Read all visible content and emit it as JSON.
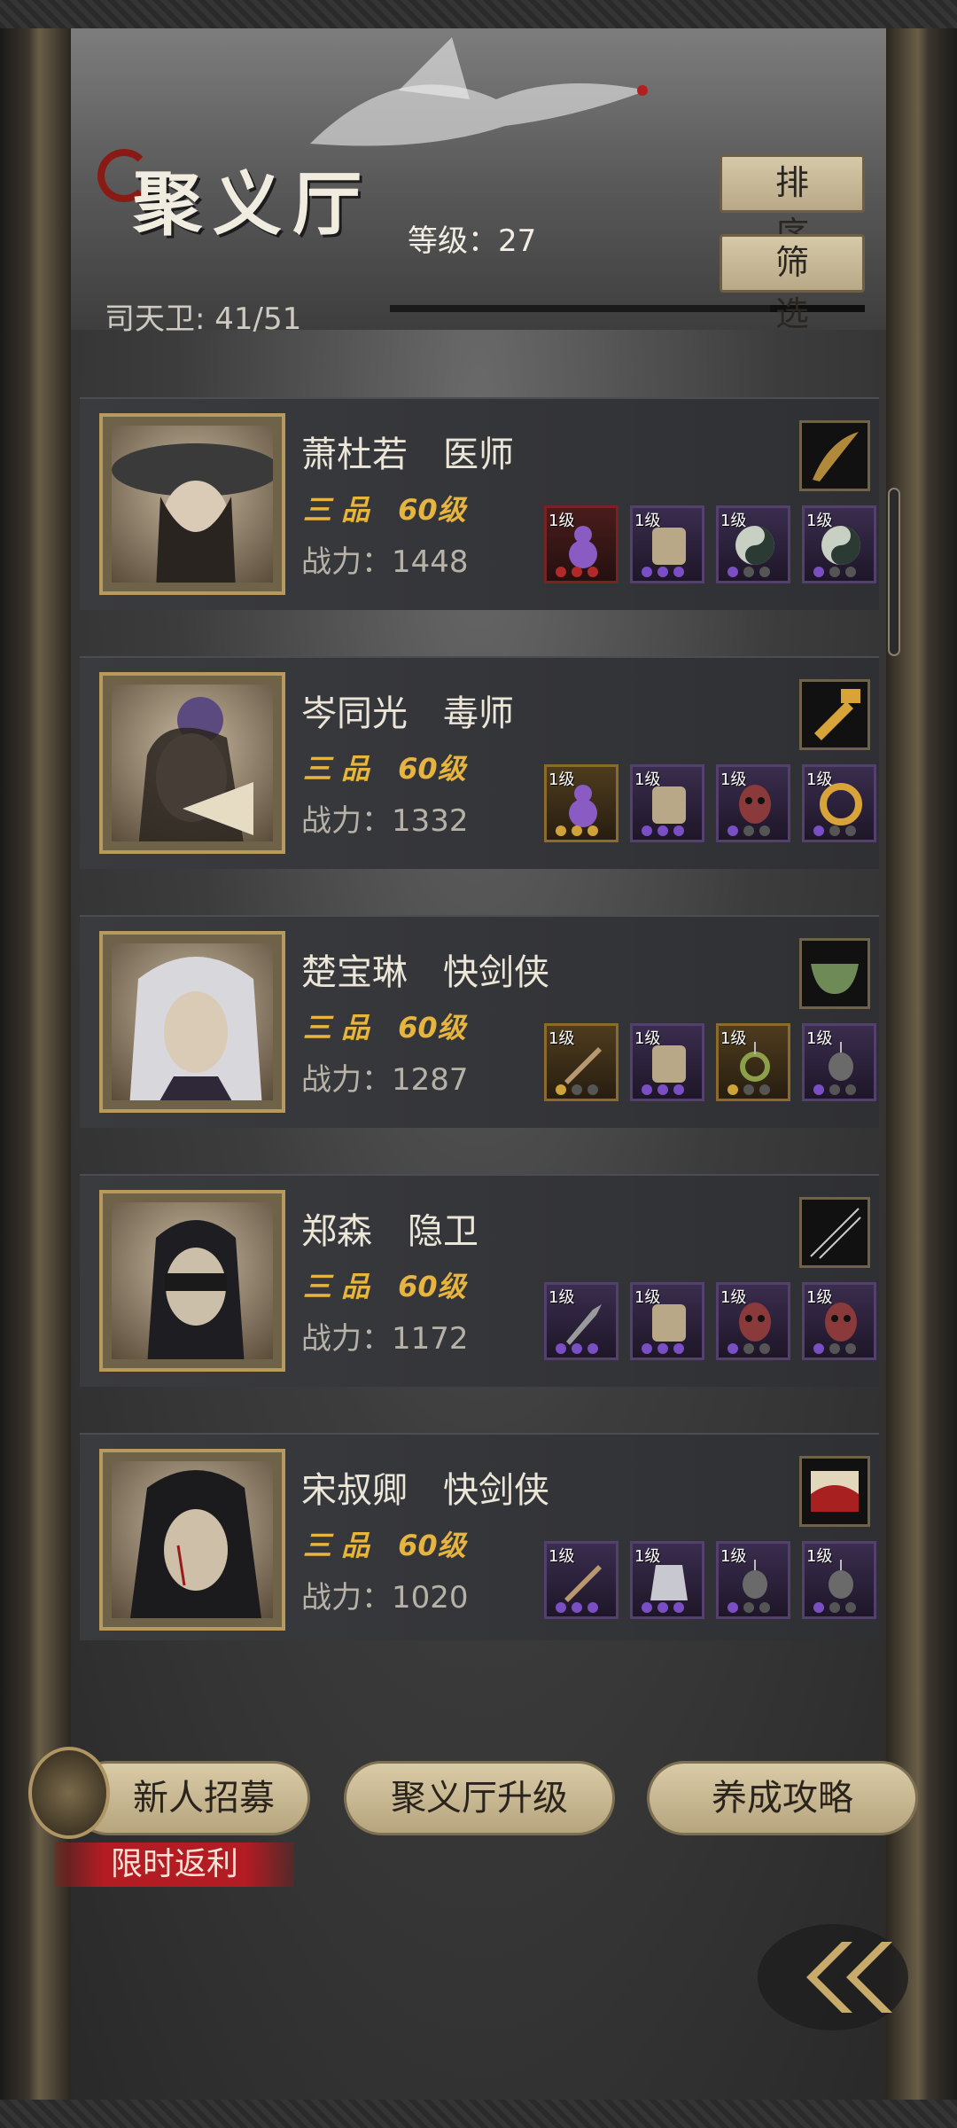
{
  "header": {
    "title": "聚义厅",
    "level_text": "等级：27",
    "members_text": "司天卫: 41/51",
    "sort_label": "排序",
    "filter_label": "筛选"
  },
  "heroes": [
    {
      "name": "萧杜若　医师",
      "rank": "三 品　60级",
      "power": "战力：1448",
      "equips": [
        {
          "lv": "1级",
          "style": "red",
          "icon": "gourd-icon"
        },
        {
          "lv": "1级",
          "style": "purple",
          "icon": "armor-icon"
        },
        {
          "lv": "1级",
          "style": "purple",
          "icon": "yin-yang-icon"
        },
        {
          "lv": "1级",
          "style": "purple",
          "icon": "yin-yang-icon"
        }
      ]
    },
    {
      "name": "岑同光　毒师",
      "rank": "三 品　60级",
      "power": "战力：1332",
      "equips": [
        {
          "lv": "1级",
          "style": "gold",
          "icon": "gourd-icon"
        },
        {
          "lv": "1级",
          "style": "purple",
          "icon": "armor-icon"
        },
        {
          "lv": "1级",
          "style": "purple",
          "icon": "mask-icon"
        },
        {
          "lv": "1级",
          "style": "purple",
          "icon": "jade-ring-icon"
        }
      ]
    },
    {
      "name": "楚宝琳　快剑侠",
      "rank": "三 品　60级",
      "power": "战力：1287",
      "equips": [
        {
          "lv": "1级",
          "style": "gold",
          "icon": "sword-icon"
        },
        {
          "lv": "1级",
          "style": "purple",
          "icon": "armor-icon"
        },
        {
          "lv": "1级",
          "style": "gold",
          "icon": "pendant-icon"
        },
        {
          "lv": "1级",
          "style": "purple",
          "icon": "amulet-icon"
        }
      ]
    },
    {
      "name": "郑森　隐卫",
      "rank": "三 品　60级",
      "power": "战力：1172",
      "equips": [
        {
          "lv": "1级",
          "style": "purple",
          "icon": "dagger-icon"
        },
        {
          "lv": "1级",
          "style": "purple",
          "icon": "armor-icon"
        },
        {
          "lv": "1级",
          "style": "purple",
          "icon": "mask-icon"
        },
        {
          "lv": "1级",
          "style": "purple",
          "icon": "mask-icon"
        }
      ]
    },
    {
      "name": "宋叔卿　快剑侠",
      "rank": "三 品　60级",
      "power": "战力：1020",
      "equips": [
        {
          "lv": "1级",
          "style": "purple",
          "icon": "sword-icon"
        },
        {
          "lv": "1级",
          "style": "purple",
          "icon": "robe-icon"
        },
        {
          "lv": "1级",
          "style": "purple",
          "icon": "amulet-icon"
        },
        {
          "lv": "1级",
          "style": "purple",
          "icon": "amulet-icon"
        }
      ]
    }
  ],
  "footer": {
    "recruit_label": "新人招募",
    "promo_label": "限时返利",
    "upgrade_label": "聚义厅升级",
    "guide_label": "养成攻略"
  },
  "colors": {
    "gold_text": "#e7b43d",
    "button_bg": "#d6c9a8",
    "promo_red": "#b21c22"
  }
}
